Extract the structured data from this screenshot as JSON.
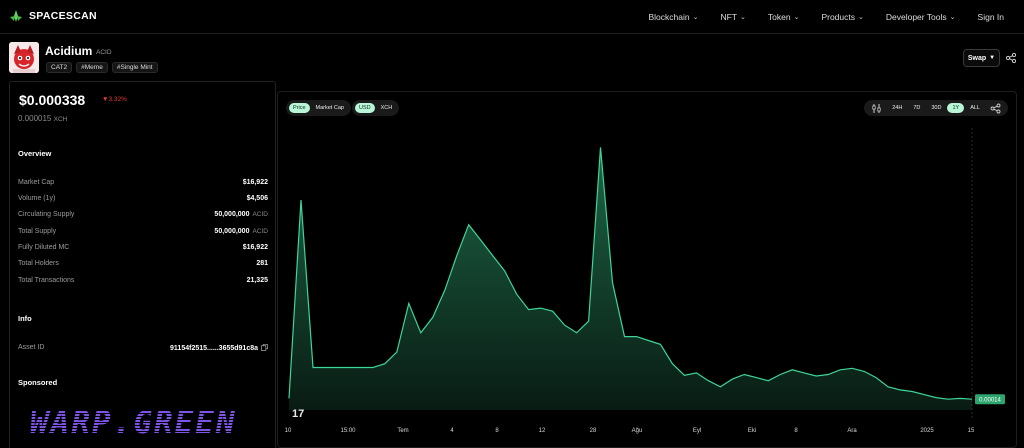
{
  "brand": {
    "name": "SPACESCAN"
  },
  "nav": {
    "items": [
      {
        "label": "Blockchain",
        "dropdown": true
      },
      {
        "label": "NFT",
        "dropdown": true
      },
      {
        "label": "Token",
        "dropdown": true
      },
      {
        "label": "Products",
        "dropdown": true
      },
      {
        "label": "Developer Tools",
        "dropdown": true
      },
      {
        "label": "Sign In",
        "dropdown": false
      }
    ]
  },
  "token": {
    "name": "Acidium",
    "ticker": "ACID",
    "tags": [
      "CAT2",
      "#Meme",
      "#Single Mint"
    ],
    "swap_label": "Swap"
  },
  "price": {
    "usd": "$0.000338",
    "change": "3.32%",
    "change_direction": "down",
    "xch": "0.000015",
    "xch_unit": "XCH"
  },
  "overview": {
    "title": "Overview",
    "rows": [
      {
        "label": "Market Cap",
        "value": "$16,922",
        "unit": ""
      },
      {
        "label": "Volume (1y)",
        "value": "$4,506",
        "unit": ""
      },
      {
        "label": "Circulating Supply",
        "value": "50,000,000",
        "unit": "ACID"
      },
      {
        "label": "Total Supply",
        "value": "50,000,000",
        "unit": "ACID"
      },
      {
        "label": "Fully Diluted MC",
        "value": "$16,922",
        "unit": ""
      },
      {
        "label": "Total Holders",
        "value": "281",
        "unit": ""
      },
      {
        "label": "Total Transactions",
        "value": "21,325",
        "unit": ""
      }
    ]
  },
  "info": {
    "title": "Info",
    "asset_id_label": "Asset ID",
    "asset_id_value": "91154f2515......3655d91c8a"
  },
  "sponsored": {
    "title": "Sponsored",
    "banner_text": "WARP.GREEN"
  },
  "chart_controls": {
    "metric": {
      "options": [
        "Price",
        "Market Cap"
      ],
      "active": "Price"
    },
    "currency": {
      "options": [
        "USD",
        "XCH"
      ],
      "active": "USD"
    },
    "ranges": {
      "options": [
        "24H",
        "7D",
        "30D",
        "1Y",
        "ALL"
      ],
      "active": "1Y"
    }
  },
  "colors": {
    "accent": "#b9f5d7",
    "line": "#3ed598",
    "fill_top": "#1f6b4a",
    "negative": "#e53b3b"
  },
  "chart_data": {
    "type": "area",
    "x_tick_labels": [
      "10",
      "15:00",
      "Tem",
      "4",
      "8",
      "12",
      "28",
      "Ağu",
      "Eyl",
      "Eki",
      "8",
      "Ara",
      "2025",
      "15"
    ],
    "y_values": [
      1.5e-05,
      0.000272,
      5.5e-05,
      5.5e-05,
      5.5e-05,
      5.5e-05,
      5.5e-05,
      5.5e-05,
      6e-05,
      7.5e-05,
      0.000138,
      0.0001,
      0.00012,
      0.000155,
      0.0002,
      0.00024,
      0.00022,
      0.0002,
      0.00018,
      0.00015,
      0.00013,
      0.000132,
      0.000128,
      0.00011,
      0.0001,
      0.000115,
      0.00034,
      0.000165,
      9.5e-05,
      9.5e-05,
      9e-05,
      8.5e-05,
      6e-05,
      4.5e-05,
      4.8e-05,
      3.8e-05,
      3e-05,
      4e-05,
      4.6e-05,
      4.2e-05,
      3.8e-05,
      4.6e-05,
      5.2e-05,
      4.8e-05,
      4.4e-05,
      4.6e-05,
      5.2e-05,
      5.4e-05,
      5e-05,
      4.2e-05,
      3e-05,
      2.6e-05,
      2.4e-05,
      2e-05,
      1.6e-05,
      1.4e-05,
      1.5e-05,
      1.4e-05
    ],
    "last_value_label": "0.00014",
    "grid": false
  }
}
